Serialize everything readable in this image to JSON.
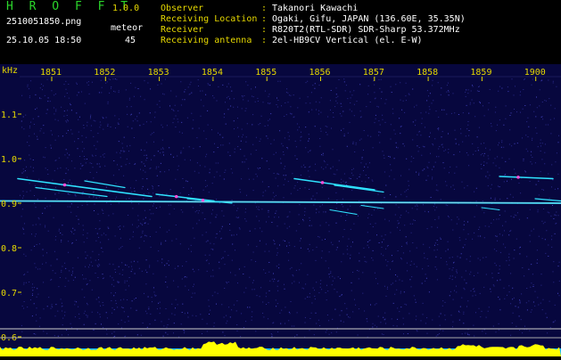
{
  "header": {
    "app_title": "H R O F F T",
    "version": "1.0.0",
    "filename": "2510051850.png",
    "datetime": "25.10.05 18:50",
    "meteor_label": "meteor",
    "meteor_count": "45"
  },
  "info": [
    {
      "key": "Observer",
      "sep": ":",
      "value": "Takanori Kawachi"
    },
    {
      "key": "Receiving Location",
      "sep": ":",
      "value": "Ogaki, Gifu, JAPAN (136.60E, 35.35N)"
    },
    {
      "key": "Receiver",
      "sep": ":",
      "value": "R820T2(RTL-SDR) SDR-Sharp 53.372MHz"
    },
    {
      "key": "Receiving antenna",
      "sep": ":",
      "value": "2el-HB9CV Vertical (el. E-W)"
    }
  ],
  "spectrogram": {
    "y_unit": "kHz",
    "y_ticks": [
      "1.1",
      "1.0",
      "0.9",
      "0.8",
      "0.7",
      "0.6"
    ],
    "y_tick_values": [
      1.1,
      1.0,
      0.9,
      0.8,
      0.7,
      0.6
    ],
    "x_ticks": [
      "1851",
      "1852",
      "1853",
      "1854",
      "1855",
      "1856",
      "1857",
      "1858",
      "1859",
      "1900"
    ],
    "colors": {
      "background": "#07073e",
      "text": "#e6d800",
      "signal": "#2fe3ff",
      "meteor_head": "#ff4fd8",
      "histogram": "#ffff00",
      "histogram_base": "#16b9ff",
      "title": "#2bd62b"
    }
  }
}
